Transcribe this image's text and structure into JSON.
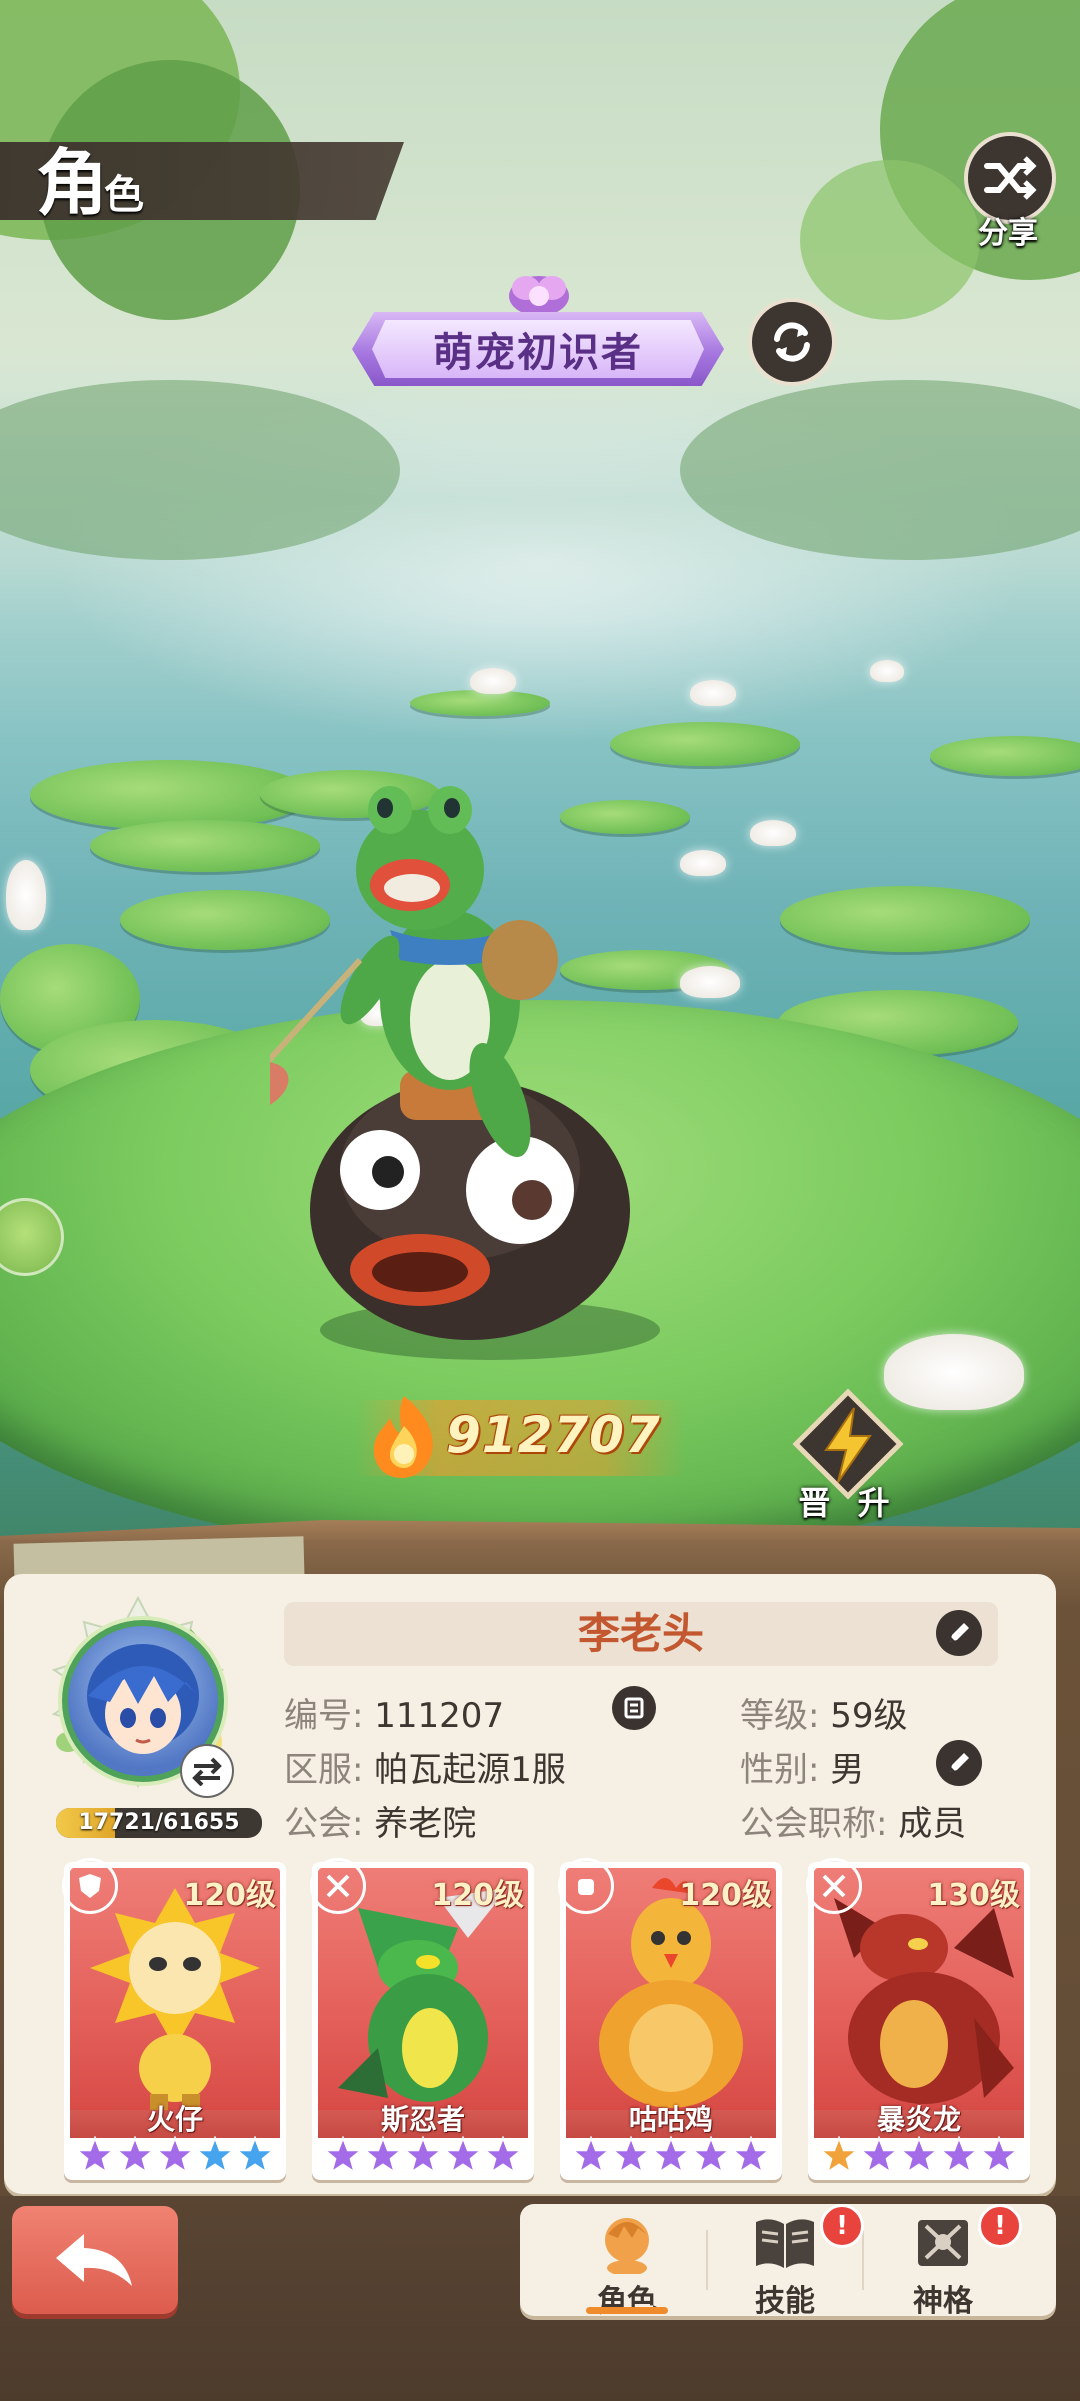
{
  "header": {
    "title_big": "角",
    "title_small": "色",
    "share_label": "分享"
  },
  "banner": {
    "title": "萌宠初识者"
  },
  "power": {
    "value": "912707"
  },
  "upgrade": {
    "label": "晋 升"
  },
  "profile": {
    "name": "李老头",
    "exp_text": "17721/61655",
    "exp_current": 17721,
    "exp_max": 61655,
    "fields": {
      "id_label": "编号:",
      "id_value": "111207",
      "level_label": "等级:",
      "level_value": "59级",
      "server_label": "区服:",
      "server_value": "帕瓦起源1服",
      "gender_label": "性别:",
      "gender_value": "男",
      "guild_label": "公会:",
      "guild_value": "养老院",
      "guild_role_label": "公会职称:",
      "guild_role_value": "成员"
    }
  },
  "pets": [
    {
      "name": "火仔",
      "level": "120级",
      "type_icon": "shield-icon",
      "type_color": "#5fb3e0",
      "stars": [
        "purple",
        "purple",
        "purple",
        "blue",
        "blue"
      ]
    },
    {
      "name": "斯忍者",
      "level": "120级",
      "type_icon": "swords-icon",
      "type_color": "#c24b3c",
      "stars": [
        "purple",
        "purple",
        "purple",
        "purple",
        "purple"
      ]
    },
    {
      "name": "咕咕鸡",
      "level": "120级",
      "type_icon": "fist-icon",
      "type_color": "#4aa84e",
      "stars": [
        "purple",
        "purple",
        "purple",
        "purple",
        "purple"
      ]
    },
    {
      "name": "暴炎龙",
      "level": "130级",
      "type_icon": "swords-icon",
      "type_color": "#c24b3c",
      "stars": [
        "orange",
        "purple",
        "purple",
        "purple",
        "purple"
      ]
    }
  ],
  "tabs": [
    {
      "label": "角色",
      "active": true
    },
    {
      "label": "技能",
      "alert": "!"
    },
    {
      "label": "神格",
      "alert": "!"
    }
  ],
  "colors": {
    "star_purple": "#a46be8",
    "star_blue": "#46a4ee",
    "star_orange": "#f2a23a",
    "accent": "#f08b2c"
  }
}
